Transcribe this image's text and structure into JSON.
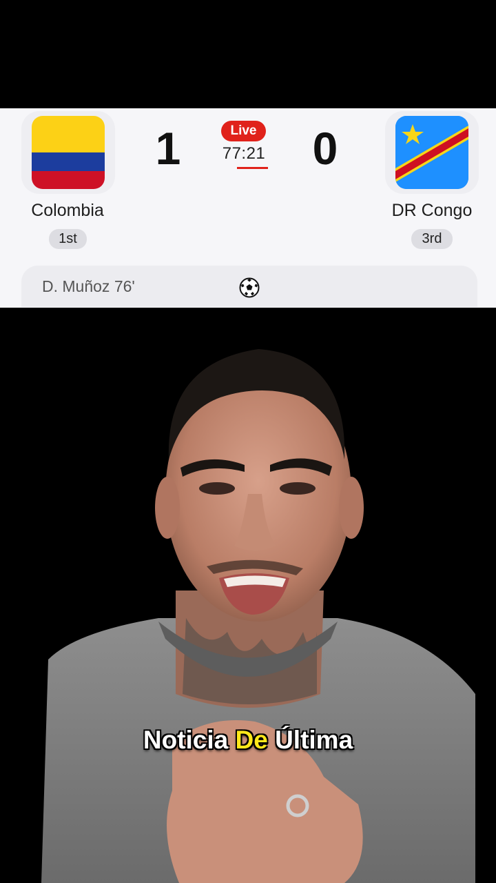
{
  "match": {
    "status": "Live",
    "clock": "77:21",
    "home": {
      "name": "Colombia",
      "rank": "1st",
      "score": "1",
      "flag": "colombia-flag"
    },
    "away": {
      "name": "DR Congo",
      "rank": "3rd",
      "score": "0",
      "flag": "dr-congo-flag"
    },
    "scorers": "D. Muñoz 76'",
    "goal_icon": "soccer-ball-icon"
  },
  "subtitle": {
    "word1": "Noticia",
    "word2": "De",
    "word3": "Última"
  },
  "colors": {
    "live_red": "#e0221b",
    "subtitle_highlight": "#ffe81a",
    "card_bg": "#f6f6f9"
  }
}
